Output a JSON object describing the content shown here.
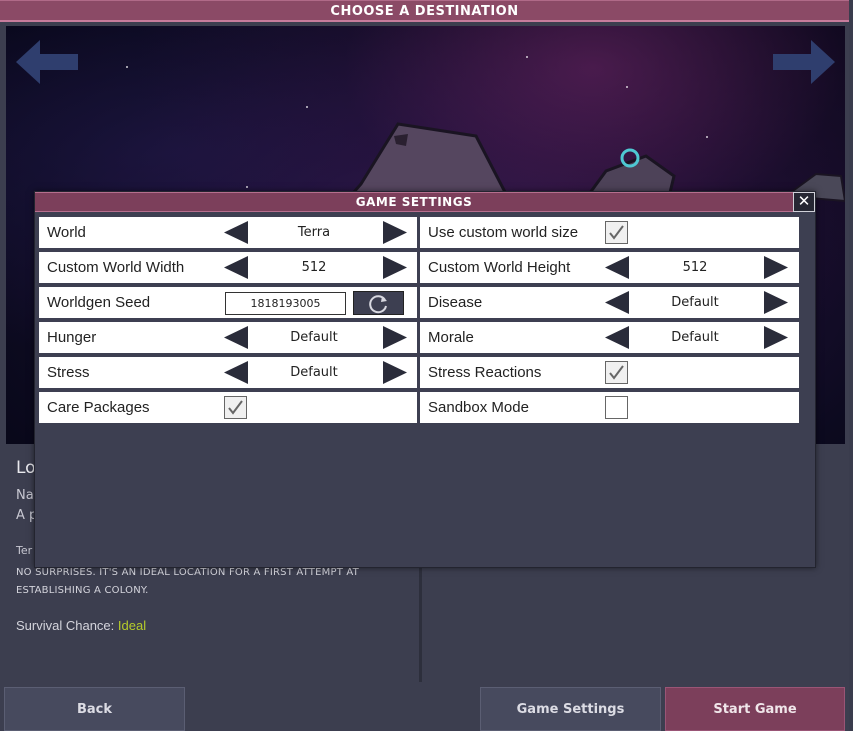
{
  "header": {
    "title": "CHOOSE A DESTINATION"
  },
  "info": {
    "title": "Lo",
    "line1": "Na",
    "line2": "A p",
    "line3": "Ter",
    "description": "NO SURPRISES. IT'S AN IDEAL LOCATION FOR A FIRST ATTEMPT AT ESTABLISHING A COLONY.",
    "survival_label": "Survival Chance:",
    "survival_value": "Ideal"
  },
  "buttons": {
    "back": "Back",
    "game_settings": "Game Settings",
    "start_game": "Start Game"
  },
  "dialog": {
    "title": "GAME SETTINGS",
    "close": "✕",
    "settings": {
      "world": {
        "label": "World",
        "value": "Terra"
      },
      "custom_size": {
        "label": "Use custom world size",
        "checked": true
      },
      "width": {
        "label": "Custom World Width",
        "value": "512"
      },
      "height": {
        "label": "Custom World Height",
        "value": "512"
      },
      "seed": {
        "label": "Worldgen Seed",
        "value": "1818193005"
      },
      "disease": {
        "label": "Disease",
        "value": "Default"
      },
      "hunger": {
        "label": "Hunger",
        "value": "Default"
      },
      "morale": {
        "label": "Morale",
        "value": "Default"
      },
      "stress": {
        "label": "Stress",
        "value": "Default"
      },
      "stress_reactions": {
        "label": "Stress Reactions",
        "checked": true
      },
      "care_packages": {
        "label": "Care Packages",
        "checked": true
      },
      "sandbox": {
        "label": "Sandbox Mode",
        "checked": false
      }
    }
  },
  "colors": {
    "accent": "#7c3f5b",
    "survival_ideal": "#b6cc2a",
    "arrow": "#2f3e6e"
  },
  "icons": {
    "prev": "arrow-left-icon",
    "next": "arrow-right-icon",
    "refresh": "refresh-icon",
    "check": "checkmark-icon"
  }
}
